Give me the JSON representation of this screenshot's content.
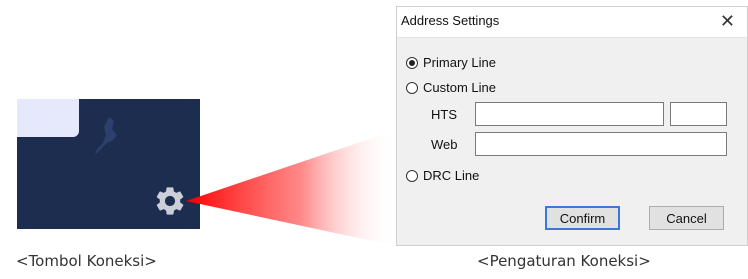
{
  "dialog": {
    "title": "Address Settings",
    "close_icon": "close-icon",
    "options": [
      {
        "label": "Primary Line",
        "checked": true
      },
      {
        "label": "Custom Line",
        "checked": false
      },
      {
        "label": "DRC Line",
        "checked": false
      }
    ],
    "hts_label": "HTS",
    "web_label": "Web",
    "hts_value": "",
    "hts_port_value": "",
    "web_value": "",
    "confirm_label": "Confirm",
    "cancel_label": "Cancel"
  },
  "thumbnail": {
    "gear_icon": "gear-icon",
    "background_color": "#1c2d4f"
  },
  "captions": {
    "left": "<Tombol Koneksi>",
    "right": "<Pengaturan Koneksi>"
  },
  "colors": {
    "beam": "#ff0000",
    "accent": "#3b78d8"
  }
}
